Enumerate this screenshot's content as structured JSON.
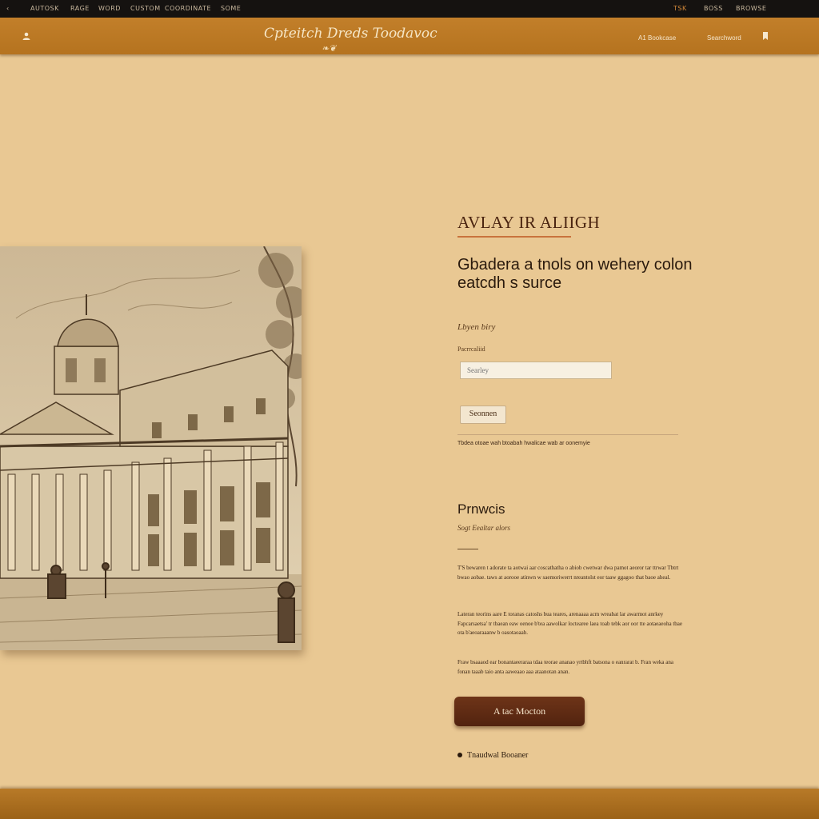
{
  "top_bar": {
    "items": [
      "‹",
      "AUTOSK",
      "RAGE",
      "WORD",
      "CUSTOM",
      "COORDINATE",
      "SOME"
    ],
    "right_items": [
      "TSK",
      "BOSS",
      "BROWSE"
    ],
    "accent_color": "#d58a3a"
  },
  "header": {
    "logo_text": "Cpteitch Dreds Toodavoc",
    "logo_flourish": "❧❦",
    "user_icon": "user-icon",
    "nav_links": [
      "A1 Bookcase",
      "Searchword"
    ],
    "bookmark_icon": "bookmark-icon",
    "bar_color": "#b5731f"
  },
  "hero": {
    "sketch_alt": "sketch-image"
  },
  "panel": {
    "eyebrow": "AVLAY IR ALIIGH",
    "headline": "Gbadera a tnols on wehery colon eatcdh s surce",
    "label_main": "Lbyen biry",
    "label_field": "Pacrrcaliid",
    "search_placeholder": "Searley",
    "search_button": "Seonnen",
    "note": "Tbdea otoae wah btoabah hwalicae wab ar oonemyie"
  },
  "section": {
    "title": "Prnwcis",
    "subtitle": "Sogt Eealtar alors",
    "para1": "T'S bewaren t adorate ta aotwai aar coscathatha o abiob cwetwar dwa pamot aeoror tar ttrwar Tbtrt bwao aobae. taws at aorooe atinwn w saemoriwerrt nreantolst eor taaw ggagoo that baoe aheal.",
    "para2": "Lateran teorins aare E toranas catoshs bua teares, arenaaaa acm wreabat lar awarmot anrkey Fapcarsaetsa' tr tbaean eaw oenoe b'tea aawolkar loctearee laea toab tebk aor oor tte aotaeaeoha tbae ota b'aeoaraaanw b oasotaoaab.",
    "para3": "Fraw bsaaaod ear bonantaeeraraa tdaa teorae ananao yrtbhft batsona o eanrarat b. Fran weka ana fonan taaab taio anta aaweaao aaa ataanotan anan."
  },
  "cta": {
    "label": "A tac Mocton"
  },
  "bullet": {
    "label": "Tnaudwal Booaner"
  },
  "colors": {
    "page_bg": "#e9c893",
    "cta_bg": "#5e2a13",
    "eyebrow_rule": "#c9733d"
  }
}
